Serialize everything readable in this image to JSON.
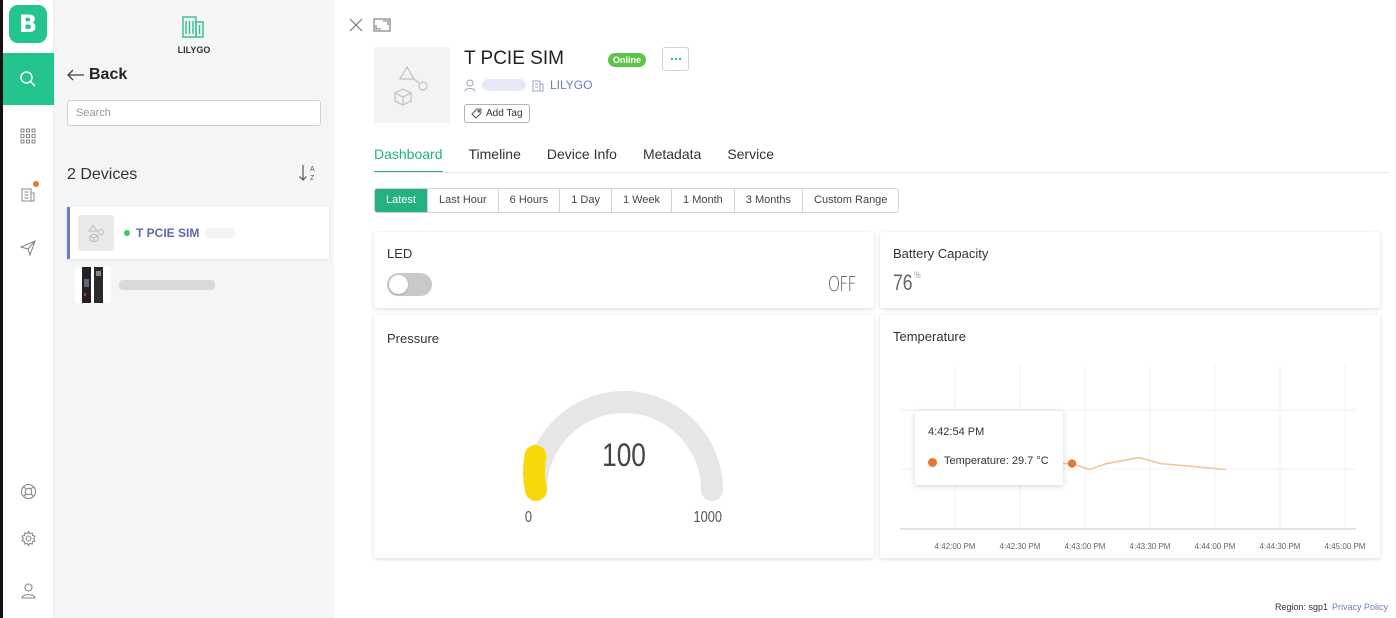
{
  "app": {
    "logo_letter": "B"
  },
  "org": {
    "name": "LILYGO"
  },
  "panel": {
    "back_label": "Back",
    "search_placeholder": "Search",
    "device_count": "2 Devices",
    "devices": [
      {
        "name": "T PCIE SIM",
        "status": "online"
      }
    ]
  },
  "device": {
    "title": "T PCIE SIM",
    "status_badge": "Online",
    "org_link": "LILYGO",
    "add_tag": "Add Tag"
  },
  "tabs": [
    "Dashboard",
    "Timeline",
    "Device Info",
    "Metadata",
    "Service"
  ],
  "time_ranges": [
    "Latest",
    "Last Hour",
    "6 Hours",
    "1 Day",
    "1 Week",
    "1 Month",
    "3 Months",
    "Custom Range"
  ],
  "widgets": {
    "led": {
      "title": "LED",
      "state": "OFF"
    },
    "battery": {
      "title": "Battery Capacity",
      "value": "76",
      "unit": "%"
    },
    "pressure": {
      "title": "Pressure",
      "value": "100",
      "min": "0",
      "max": "1000"
    },
    "temperature": {
      "title": "Temperature",
      "tooltip_time": "4:42:54 PM",
      "tooltip_value": "Temperature: 29.7 °C"
    }
  },
  "chart_data": {
    "type": "line",
    "title": "Temperature",
    "x_tick_labels": [
      "4:42:00 PM",
      "4:42:30 PM",
      "4:43:00 PM",
      "4:43:30 PM",
      "4:44:00 PM",
      "4:44:30 PM",
      "4:45:00 PM"
    ],
    "series": [
      {
        "name": "Temperature",
        "color": "#f5c49a",
        "points": [
          {
            "t": 40,
            "y": 29.7
          },
          {
            "t": 54,
            "y": 29.7
          },
          {
            "t": 62,
            "y": 29.6
          },
          {
            "t": 70,
            "y": 29.7
          },
          {
            "t": 85,
            "y": 29.8
          },
          {
            "t": 95,
            "y": 29.7
          },
          {
            "t": 125,
            "y": 29.6
          }
        ]
      }
    ],
    "highlight_point": {
      "t": 54,
      "y": 29.7
    }
  },
  "footer": {
    "region": "Region: sgp1",
    "privacy": "Privacy Policy"
  }
}
